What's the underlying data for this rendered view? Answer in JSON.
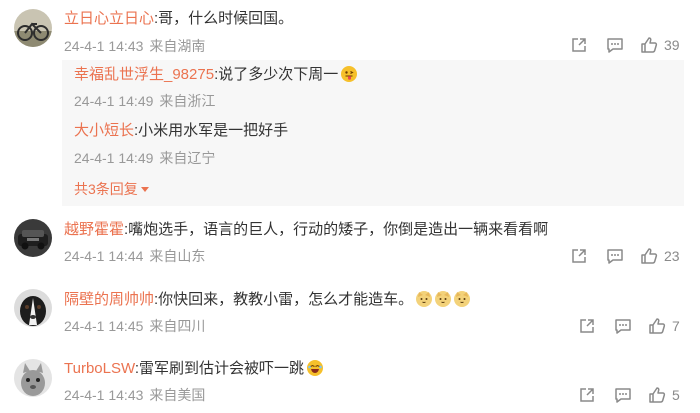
{
  "comments": [
    {
      "user": "立日心立日心",
      "text": ":哥，什么时候回国。",
      "time": "24-4-1 14:43",
      "source": "来自湖南",
      "likes": "39",
      "replies": [
        {
          "user": "幸福乱世浮生_98275",
          "text": ":说了多少次下周一",
          "time": "24-4-1 14:49",
          "source": "来自浙江",
          "emoji": "tongue-emoji"
        },
        {
          "user": "大小短长",
          "text": ":小米用水军是一把好手",
          "time": "24-4-1 14:49",
          "source": "来自辽宁"
        }
      ],
      "more_replies": "共3条回复"
    },
    {
      "user": "越野霍霍",
      "text": ":嘴炮选手，语言的巨人，行动的矮子，你倒是造出一辆来看看啊",
      "time": "24-4-1 14:44",
      "source": "来自山东",
      "likes": "23"
    },
    {
      "user": "隔壁的周帅帅",
      "text": ":你快回来，教教小雷，怎么才能造车。",
      "time": "24-4-1 14:45",
      "source": "来自四川",
      "likes": "7",
      "emojis": [
        "cat-emoji",
        "cat-emoji",
        "cat-emoji"
      ]
    },
    {
      "user": "TurboLSW",
      "text": ":雷军刷到估计会被吓一跳",
      "time": "24-4-1 14:43",
      "source": "来自美国",
      "likes": "5",
      "emoji": "laugh-emoji"
    }
  ],
  "colors": {
    "username": "#eb7350",
    "meta": "#999999",
    "reply_bg": "#f7f7f7",
    "icon": "#8a8a8a"
  }
}
